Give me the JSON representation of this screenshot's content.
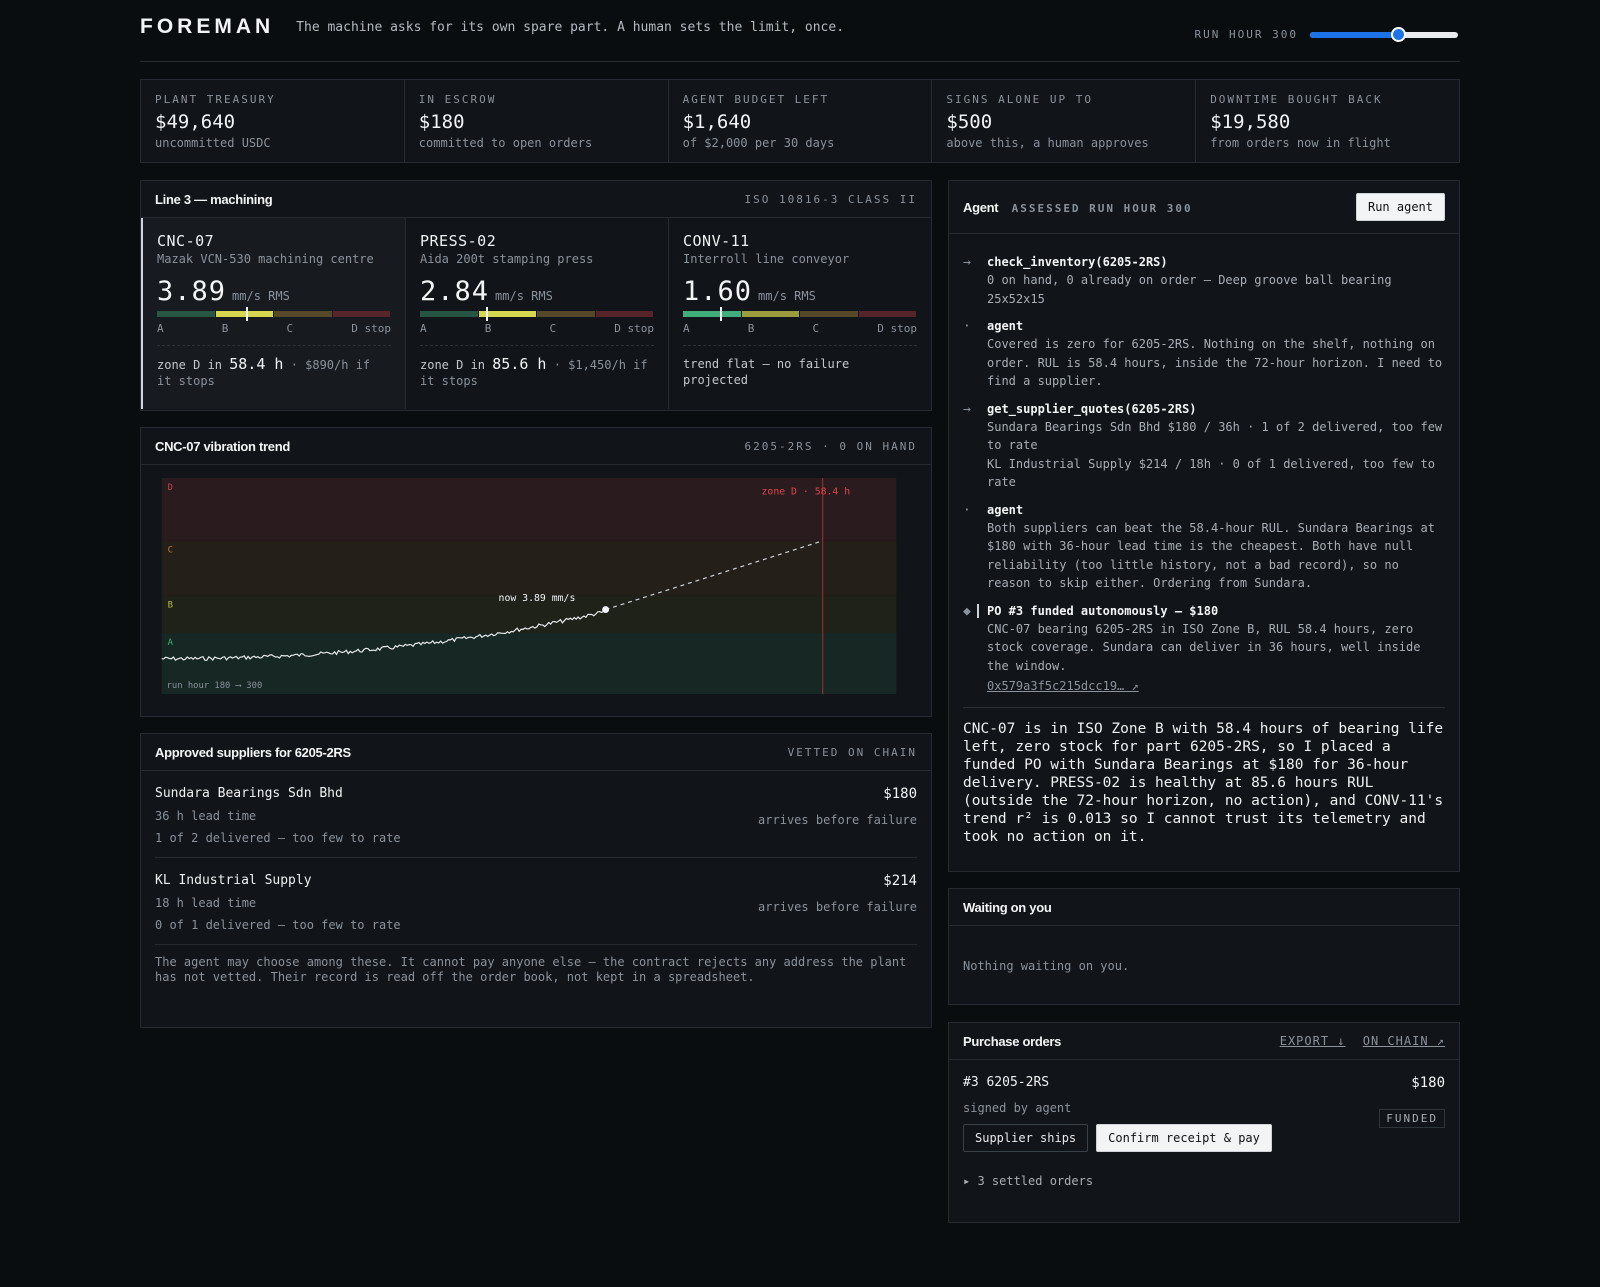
{
  "header": {
    "brand": "FOREMAN",
    "tagline": "The machine asks for its own spare part. A human sets the limit, once.",
    "run_hour_label": "RUN HOUR 300",
    "run_hour_fraction": 0.6
  },
  "stats": [
    {
      "label": "PLANT TREASURY",
      "value": "$49,640",
      "sub": "uncommitted USDC"
    },
    {
      "label": "IN ESCROW",
      "value": "$180",
      "sub": "committed to open orders"
    },
    {
      "label": "AGENT BUDGET LEFT",
      "value": "$1,640",
      "sub": "of $2,000 per 30 days"
    },
    {
      "label": "SIGNS ALONE UP TO",
      "value": "$500",
      "sub": "above this, a human approves"
    },
    {
      "label": "DOWNTIME BOUGHT BACK",
      "value": "$19,580",
      "sub": "from orders now in flight"
    }
  ],
  "line": {
    "title": "Line 3 — machining",
    "tag": "ISO 10816-3 CLASS II",
    "zone_labels": [
      "A",
      "B",
      "C",
      "D stop"
    ],
    "machines": [
      {
        "id": "CNC-07",
        "desc": "Mazak VCN-530 machining centre",
        "value": "3.89",
        "unit": "mm/s RMS",
        "marker": 0.38,
        "highlight": 1,
        "foot_pre": "zone D in",
        "foot_val": "58.4 h",
        "foot_post": "· $890/h if it stops"
      },
      {
        "id": "PRESS-02",
        "desc": "Aida 200t stamping press",
        "value": "2.84",
        "unit": "mm/s RMS",
        "marker": 0.28,
        "highlight": 1,
        "foot_pre": "zone D in",
        "foot_val": "85.6 h",
        "foot_post": "· $1,450/h if it stops"
      },
      {
        "id": "CONV-11",
        "desc": "Interroll line conveyor",
        "value": "1.60",
        "unit": "mm/s RMS",
        "marker": 0.16,
        "highlight": 0,
        "foot_pre": "trend flat — no failure projected",
        "foot_val": "",
        "foot_post": ""
      }
    ]
  },
  "trend": {
    "title": "CNC-07 vibration trend",
    "tag": "6205-2RS · 0 ON HAND",
    "zones": [
      "A",
      "B",
      "C",
      "D"
    ],
    "zone_d_label": "zone D · 58.4 h",
    "now_label": "now 3.89 mm/s",
    "axis_label": "run hour 180 ⟶ 300"
  },
  "suppliers": {
    "title": "Approved suppliers for 6205-2RS",
    "tag": "VETTED ON CHAIN",
    "items": [
      {
        "name": "Sundara Bearings Sdn Bhd",
        "price": "$180",
        "lead": "36 h lead time",
        "arrive": "arrives before failure",
        "record": "1 of 2 delivered — too few to rate"
      },
      {
        "name": "KL Industrial Supply",
        "price": "$214",
        "lead": "18 h lead time",
        "arrive": "arrives before failure",
        "record": "0 of 1 delivered — too few to rate"
      }
    ],
    "note": "The agent may choose among these. It cannot pay anyone else — the contract rejects any address the plant has not vetted. Their record is read off the order book, not kept in a spreadsheet."
  },
  "agent": {
    "title": "Agent",
    "assessed": "ASSESSED RUN HOUR 300",
    "run_button": "Run agent",
    "steps": [
      {
        "icon": "→",
        "title": "check_inventory(6205-2RS)",
        "body": "0 on hand, 0 already on order — Deep groove ball bearing 25x52x15"
      },
      {
        "icon": "·",
        "title": "agent",
        "body": "Covered is zero for 6205-2RS. Nothing on the shelf, nothing on order. RUL is 58.4 hours, inside the 72-hour horizon. I need to find a supplier."
      },
      {
        "icon": "→",
        "title": "get_supplier_quotes(6205-2RS)",
        "body": "Sundara Bearings Sdn Bhd $180 / 36h · 1 of 2 delivered, too few to rate\nKL Industrial Supply $214 / 18h · 0 of 1 delivered, too few to rate"
      },
      {
        "icon": "·",
        "title": "agent",
        "body": "Both suppliers can beat the 58.4-hour RUL. Sundara Bearings at $180 with 36-hour lead time is the cheapest. Both have null reliability (too little history, not a bad record), so no reason to skip either. Ordering from Sundara."
      },
      {
        "icon": "◆",
        "title": "PO #3 funded autonomously — $180",
        "body": "CNC-07 bearing 6205-2RS in ISO Zone B, RUL 58.4 hours, zero stock coverage. Sundara can deliver in 36 hours, well inside the window.",
        "link": "0x579a3f5c215dcc19… ↗"
      }
    ],
    "summary": "CNC-07 is in ISO Zone B with 58.4 hours of bearing life left, zero stock for part 6205-2RS, so I placed a funded PO with Sundara Bearings at $180 for 36-hour delivery. PRESS-02 is healthy at 85.6 hours RUL (outside the 72-hour horizon, no action), and CONV-11's trend r² is 0.013 so I cannot trust its telemetry and took no action on it."
  },
  "waiting": {
    "title": "Waiting on you",
    "empty": "Nothing waiting on you."
  },
  "orders": {
    "title": "Purchase orders",
    "export": "EXPORT ↓",
    "onchain": "ON CHAIN ↗",
    "po": {
      "id": "#3 6205-2RS",
      "price": "$180",
      "signed": "signed by agent",
      "status": "FUNDED"
    },
    "ship_button": "Supplier ships",
    "confirm_button": "Confirm receipt & pay",
    "settled": "▸ 3 settled orders"
  },
  "colors": {
    "zoneA": "#2f6b52",
    "zoneB": "#c9c94a",
    "zoneC": "#6b5a2e",
    "zoneD": "#6b2a2e",
    "accent": "#1c73e8",
    "alert": "#e0474a"
  }
}
